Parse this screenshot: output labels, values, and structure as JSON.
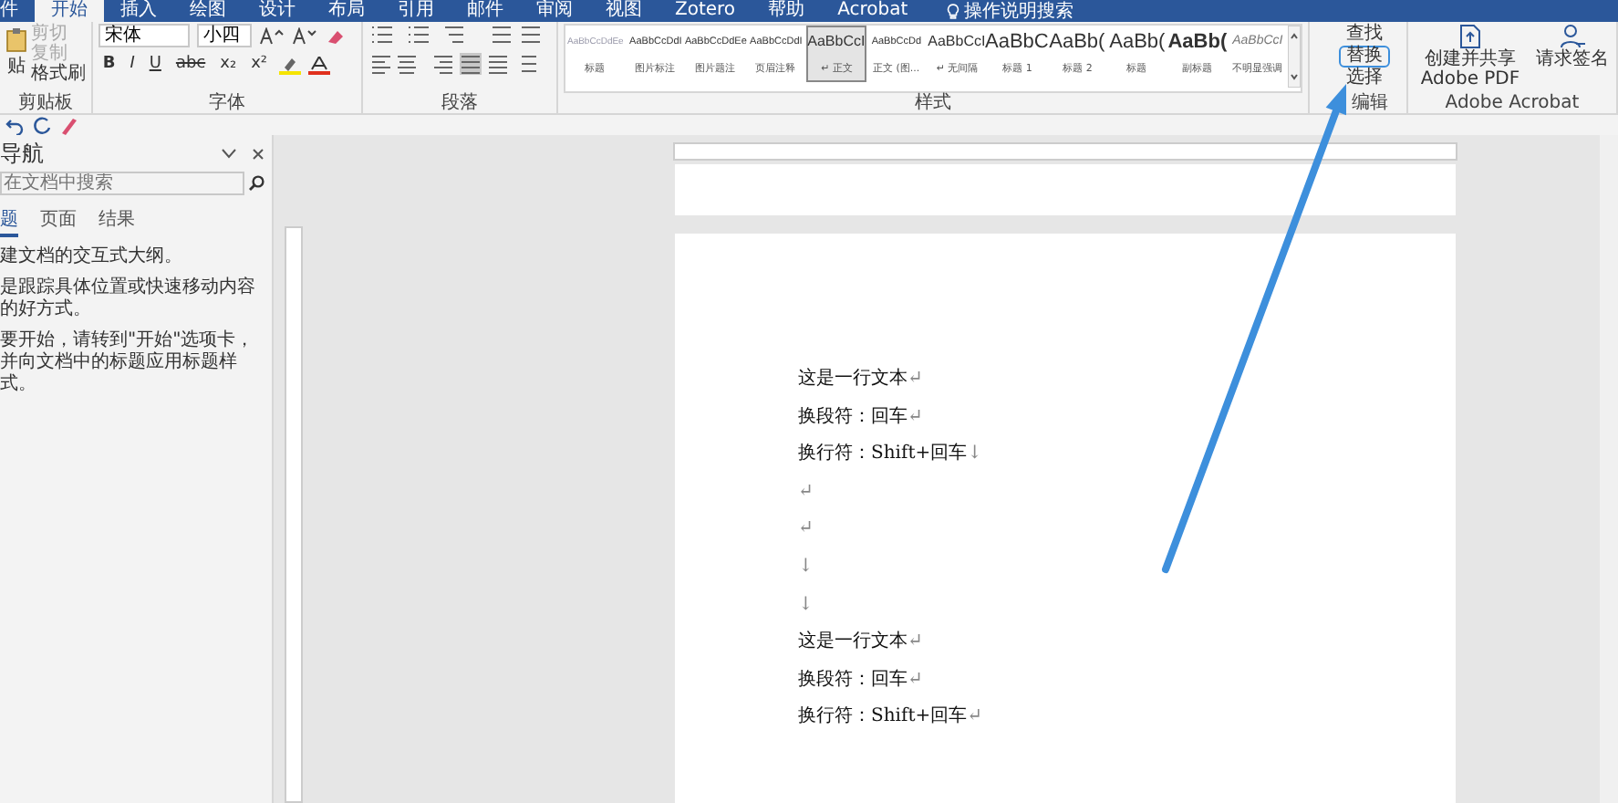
{
  "tabs": [
    {
      "label": "件",
      "selected": false
    },
    {
      "label": "开始",
      "selected": true
    },
    {
      "label": "插入",
      "selected": false
    },
    {
      "label": "绘图",
      "selected": false
    },
    {
      "label": "设计",
      "selected": false
    },
    {
      "label": "布局",
      "selected": false
    },
    {
      "label": "引用",
      "selected": false
    },
    {
      "label": "邮件",
      "selected": false
    },
    {
      "label": "审阅",
      "selected": false
    },
    {
      "label": "视图",
      "selected": false
    },
    {
      "label": "Zotero",
      "selected": false
    },
    {
      "label": "帮助",
      "selected": false
    },
    {
      "label": "Acrobat",
      "selected": false
    }
  ],
  "tell_me": "操作说明搜索",
  "clipboard": {
    "paste_label": "贴",
    "items": [
      {
        "label": "剪切",
        "disabled": true
      },
      {
        "label": "复制",
        "disabled": true
      },
      {
        "label": "格式刷",
        "disabled": false
      }
    ],
    "group_label": "剪贴板"
  },
  "font": {
    "font_name": "宋体",
    "font_size": "小四",
    "buttons": [
      "B",
      "I",
      "U",
      "abc",
      "x₂",
      "x²"
    ],
    "group_label": "字体"
  },
  "paragraph": {
    "group_label": "段落"
  },
  "styles": {
    "items": [
      {
        "preview": "AaBbCcDdEe",
        "name": "标题",
        "kind": "faint",
        "selected": false
      },
      {
        "preview": "AaBbCcDdI",
        "name": "图片标注",
        "kind": "small",
        "selected": false
      },
      {
        "preview": "AaBbCcDdEe",
        "name": "图片题注",
        "kind": "small",
        "selected": false
      },
      {
        "preview": "AaBbCcDdI",
        "name": "页眉注释",
        "kind": "small",
        "selected": false
      },
      {
        "preview": "AaBbCcI",
        "name": "↵ 正文",
        "kind": "normal",
        "selected": true
      },
      {
        "preview": "AaBbCcDd",
        "name": "正文 (图...",
        "kind": "small",
        "selected": false
      },
      {
        "preview": "AaBbCcI",
        "name": "↵ 无间隔",
        "kind": "normal",
        "selected": false
      },
      {
        "preview": "AaBbC",
        "name": "标题 1",
        "kind": "heading",
        "selected": false
      },
      {
        "preview": "AaBb(",
        "name": "标题 2",
        "kind": "heading",
        "selected": false
      },
      {
        "preview": "AaBb(",
        "name": "标题",
        "kind": "heading",
        "selected": false
      },
      {
        "preview": "AaBb(",
        "name": "副标题",
        "kind": "strong",
        "selected": false
      },
      {
        "preview": "AaBbCcI",
        "name": "不明显强调",
        "kind": "emphasis",
        "selected": false
      }
    ],
    "group_label": "样式"
  },
  "editing": {
    "items": [
      {
        "label": "查找",
        "highlighted": false
      },
      {
        "label": "替换",
        "highlighted": true
      },
      {
        "label": "选择",
        "highlighted": false
      }
    ],
    "group_label": "编辑"
  },
  "acrobat": {
    "buttons": [
      "创建并共享 Adobe PDF",
      "请求签名"
    ],
    "group_label": "Adobe Acrobat"
  },
  "nav": {
    "title": "导航",
    "search_placeholder": "在文档中搜索",
    "tabs": [
      {
        "label": "题",
        "selected": true
      },
      {
        "label": "页面",
        "selected": false
      },
      {
        "label": "结果",
        "selected": false
      }
    ],
    "messages": [
      "建文档的交互式大纲。",
      "是跟踪具体位置或快速移动内容的好方式。",
      "要开始，请转到\"开始\"选项卡，并向文档中的标题应用标题样式。"
    ]
  },
  "document": {
    "lines": [
      {
        "text": "这是一行文本",
        "mark": "↵"
      },
      {
        "text": "换段符：回车",
        "mark": "↵"
      },
      {
        "text": "换行符：Shift+回车",
        "mark": "↓"
      },
      {
        "mark": "↵"
      },
      {
        "mark": "↵"
      },
      {
        "mark": "↓"
      },
      {
        "mark": "↓"
      },
      {
        "text": "这是一行文本",
        "mark": "↵"
      },
      {
        "text": "换段符：回车",
        "mark": "↵"
      },
      {
        "text": "换行符：Shift+回车",
        "mark": "↵"
      }
    ]
  }
}
